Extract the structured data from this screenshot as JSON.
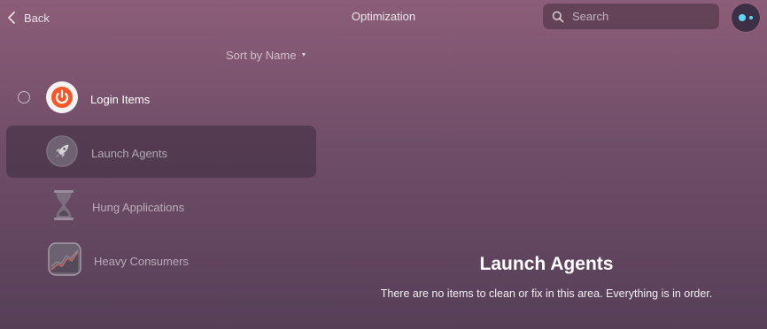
{
  "header": {
    "back_label": "Back",
    "title": "Optimization",
    "search_placeholder": "Search"
  },
  "list": {
    "sort_label": "Sort by Name",
    "items": [
      {
        "label": "Login Items",
        "icon": "power-icon"
      },
      {
        "label": "Launch Agents",
        "icon": "rocket-icon"
      },
      {
        "label": "Hung Applications",
        "icon": "hourglass-icon"
      },
      {
        "label": "Heavy Consumers",
        "icon": "activity-graph-icon"
      }
    ],
    "selected": "Launch Agents"
  },
  "detail": {
    "title": "Launch Agents",
    "message": "There are no items to clean or fix in this area. Everything is in order."
  },
  "colors": {
    "accent_orange": "#f2582a",
    "assistant_blue": "#5fd5ff"
  }
}
